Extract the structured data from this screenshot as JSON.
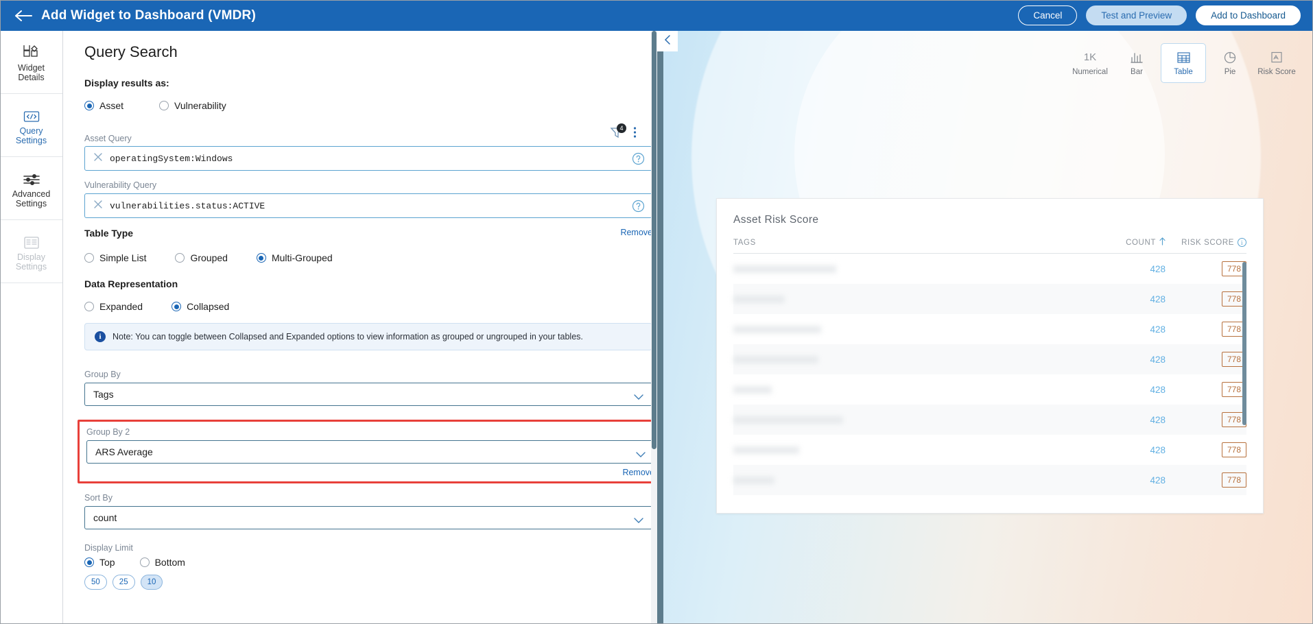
{
  "topbar": {
    "back_icon": "arrow-left-icon",
    "title": "Add Widget to Dashboard (VMDR)",
    "cancel_label": "Cancel",
    "test_label": "Test and Preview",
    "add_label": "Add to Dashboard"
  },
  "rail": {
    "items": [
      {
        "label_line1": "Widget",
        "label_line2": "Details",
        "icon": "widget-details-icon",
        "state": "normal"
      },
      {
        "label_line1": "Query",
        "label_line2": "Settings",
        "icon": "code-brackets-icon",
        "state": "active"
      },
      {
        "label_line1": "Advanced",
        "label_line2": "Settings",
        "icon": "sliders-icon",
        "state": "normal"
      },
      {
        "label_line1": "Display",
        "label_line2": "Settings",
        "icon": "display-settings-icon",
        "state": "disabled"
      }
    ]
  },
  "form": {
    "page_title": "Query Search",
    "display_results_label": "Display results as:",
    "display_results_options": [
      {
        "label": "Asset",
        "selected": true
      },
      {
        "label": "Vulnerability",
        "selected": false
      }
    ],
    "asset_query": {
      "label": "Asset Query",
      "value": "operatingSystem:Windows",
      "filter_badge_count": "4",
      "filter_icon": "funnel-icon",
      "more_icon": "kebab-menu-icon",
      "clear_icon": "close-x-icon",
      "help_icon": "question-mark-icon"
    },
    "vulnerability_query": {
      "label": "Vulnerability Query",
      "value": "vulnerabilities.status:ACTIVE",
      "clear_icon": "close-x-icon",
      "help_icon": "question-mark-icon",
      "remove_label": "Remove"
    },
    "table_type": {
      "label": "Table Type",
      "options": [
        {
          "label": "Simple List",
          "selected": false
        },
        {
          "label": "Grouped",
          "selected": false
        },
        {
          "label": "Multi-Grouped",
          "selected": true
        }
      ]
    },
    "data_representation": {
      "label": "Data Representation",
      "options": [
        {
          "label": "Expanded",
          "selected": false
        },
        {
          "label": "Collapsed",
          "selected": true
        }
      ]
    },
    "note": {
      "icon": "info-icon",
      "text": "Note: You can toggle between Collapsed and Expanded options to view information as grouped or ungrouped in your tables."
    },
    "group_by": {
      "label": "Group By",
      "value": "Tags",
      "chevron": "chevron-down-icon"
    },
    "group_by_2": {
      "label": "Group By 2",
      "value": "ARS Average",
      "chevron": "chevron-down-icon",
      "remove_label": "Remove",
      "highlight_color": "#e8403a"
    },
    "sort_by": {
      "label": "Sort By",
      "value": "count",
      "chevron": "chevron-down-icon"
    },
    "display_limit": {
      "label": "Display Limit",
      "options": [
        {
          "label": "Top",
          "selected": true
        },
        {
          "label": "Bottom",
          "selected": false
        }
      ],
      "pills": [
        {
          "label": "50",
          "selected": false
        },
        {
          "label": "25",
          "selected": false
        },
        {
          "label": "10",
          "selected": true
        }
      ]
    }
  },
  "preview": {
    "collapse_icon": "chevron-left-icon",
    "chart_types": [
      {
        "label": "Numerical",
        "icon": "1K",
        "active": false
      },
      {
        "label": "Bar",
        "icon": "bar-chart-icon",
        "active": false
      },
      {
        "label": "Table",
        "icon": "table-grid-icon",
        "active": true
      },
      {
        "label": "Pie",
        "icon": "pie-chart-icon",
        "active": false
      },
      {
        "label": "Risk Score",
        "icon": "risk-score-icon",
        "active": false
      }
    ],
    "widget": {
      "title": "Asset Risk Score",
      "columns": [
        "TAGS",
        "COUNT",
        "RISK SCORE"
      ],
      "sort_icon": "arrow-up-icon",
      "risk_info_icon": "info-circle-icon",
      "rows": [
        {
          "tag": "",
          "tag_blurred": true,
          "count": "428",
          "risk_score": "778"
        },
        {
          "tag": "",
          "tag_blurred": true,
          "count": "428",
          "risk_score": "778"
        },
        {
          "tag": "",
          "tag_blurred": true,
          "count": "428",
          "risk_score": "778"
        },
        {
          "tag": "",
          "tag_blurred": true,
          "count": "428",
          "risk_score": "778"
        },
        {
          "tag": "",
          "tag_blurred": true,
          "count": "428",
          "risk_score": "778"
        },
        {
          "tag": "",
          "tag_blurred": true,
          "count": "428",
          "risk_score": "778"
        },
        {
          "tag": "",
          "tag_blurred": true,
          "count": "428",
          "risk_score": "778"
        },
        {
          "tag": "",
          "tag_blurred": true,
          "count": "428",
          "risk_score": "778"
        }
      ]
    }
  },
  "colors": {
    "brand_blue": "#1a66b5",
    "link_blue": "#1a66b5",
    "count_blue": "#62b0e3",
    "risk_orange": "#b7703c",
    "highlight_red": "#e8403a"
  }
}
